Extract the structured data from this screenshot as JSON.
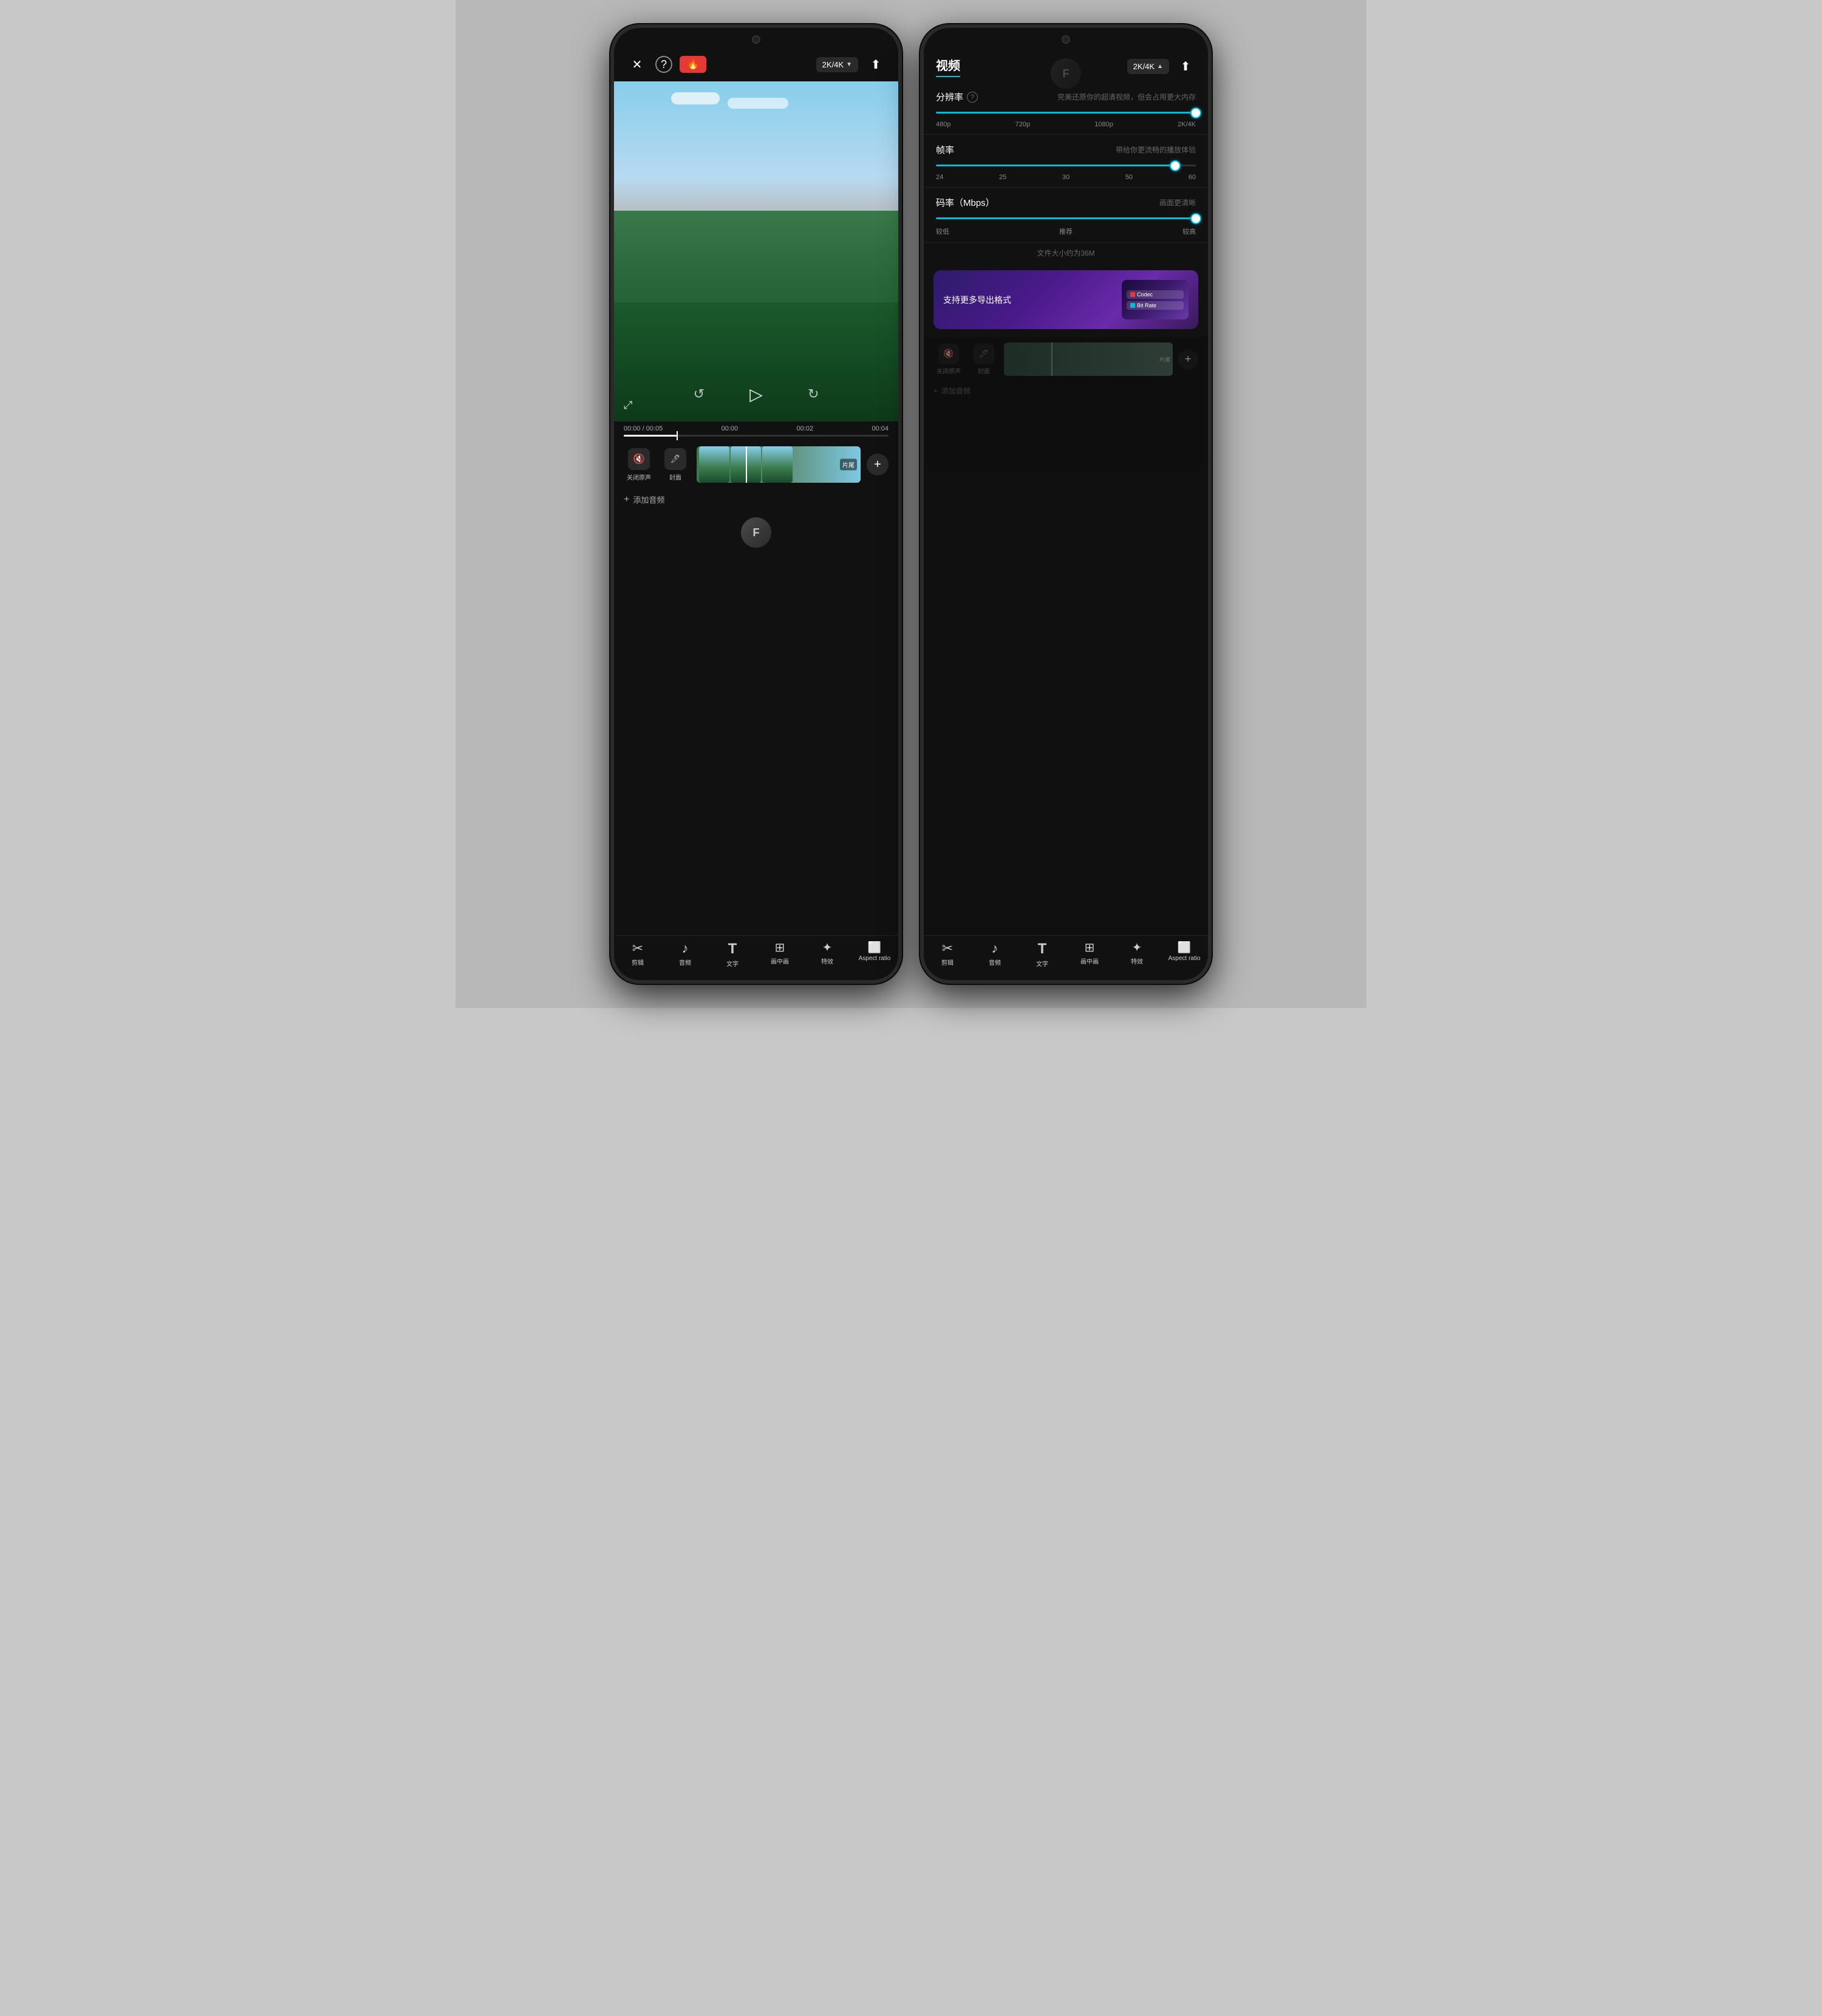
{
  "left_phone": {
    "top_bar": {
      "close_label": "✕",
      "help_label": "?",
      "quality_label": "2K/4K",
      "quality_arrow": "▼",
      "upload_label": "↑"
    },
    "video_controls": {
      "play_label": "▷",
      "fullscreen_label": "⤢",
      "rotate_left": "↺",
      "rotate_right": "↻"
    },
    "timeline": {
      "time_current": "00:00",
      "time_total": "00:05",
      "marks": [
        "00:00",
        "00:02",
        "00:04"
      ]
    },
    "tracks": {
      "mute_label": "关闭原声",
      "cover_label": "封面",
      "end_label": "片尾",
      "add_audio_label": "添加音频"
    },
    "bottom_toolbar": {
      "items": [
        {
          "icon": "✂",
          "label": "剪辑"
        },
        {
          "icon": "♪",
          "label": "音频"
        },
        {
          "icon": "T",
          "label": "文字"
        },
        {
          "icon": "⊞",
          "label": "画中画"
        },
        {
          "icon": "✦",
          "label": "特效"
        },
        {
          "icon": "▢",
          "label": "Aspect ratio"
        }
      ]
    },
    "brand": "F"
  },
  "right_phone": {
    "top_bar": {
      "title": "视频",
      "quality_label": "2K/4K",
      "quality_arrow": "▲",
      "upload_label": "↑"
    },
    "brand": "F",
    "resolution_section": {
      "label": "分辨率",
      "hint_label": "?",
      "description": "完美还原你的超清视频，但会占用更大内存",
      "slider_value": 100,
      "marks": [
        "480p",
        "720p",
        "1080p",
        "2K/4K"
      ]
    },
    "framerate_section": {
      "label": "帧率",
      "description": "带给你更流畅的播放体验",
      "slider_value": 92,
      "marks": [
        "24",
        "25",
        "30",
        "50",
        "60"
      ]
    },
    "bitrate_section": {
      "label": "码率（Mbps）",
      "description": "画面更清晰",
      "slider_value": 100,
      "marks_left": "较低",
      "marks_mid": "推荐",
      "marks_right": "较高"
    },
    "file_size": "文件大小约为36M",
    "formats_banner": {
      "text": "支持更多导出格式",
      "codec_label": "Codec",
      "bitrate_label": "Bit Rate"
    },
    "bottom_toolbar": {
      "items": [
        {
          "icon": "✂",
          "label": "剪辑"
        },
        {
          "icon": "♪",
          "label": "音频"
        },
        {
          "icon": "T",
          "label": "文字"
        },
        {
          "icon": "⊞",
          "label": "画中画"
        },
        {
          "icon": "✦",
          "label": "特效"
        },
        {
          "icon": "▢",
          "label": "Aspect ratio"
        }
      ]
    }
  }
}
